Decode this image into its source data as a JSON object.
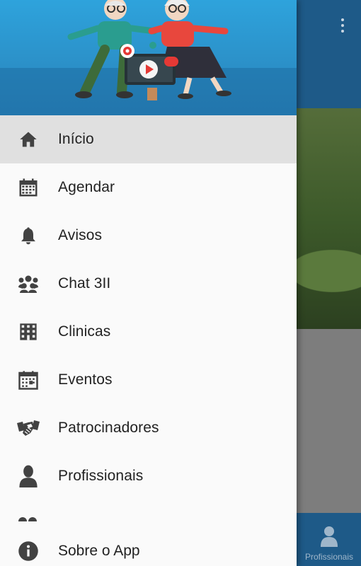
{
  "background_app": {
    "bottom_tab_label": "Profissionais"
  },
  "drawer": {
    "menu": [
      {
        "label": "Início",
        "icon": "home-icon",
        "active": true
      },
      {
        "label": "Agendar",
        "icon": "calendar-icon"
      },
      {
        "label": "Avisos",
        "icon": "bell-icon"
      },
      {
        "label": "Chat 3II",
        "icon": "group-icon"
      },
      {
        "label": "Clinicas",
        "icon": "building-icon"
      },
      {
        "label": "Eventos",
        "icon": "event-calendar-icon"
      },
      {
        "label": "Patrocinadores",
        "icon": "handshake-icon"
      },
      {
        "label": "Profissionais",
        "icon": "person-icon"
      }
    ],
    "footer_item": {
      "label": "Sobre o App",
      "icon": "info-icon"
    }
  },
  "colors": {
    "app_bar": "#1e5a88",
    "drawer_header": "#2ea3dc",
    "active_item_bg": "#e0e0e0",
    "icon": "#424242"
  }
}
